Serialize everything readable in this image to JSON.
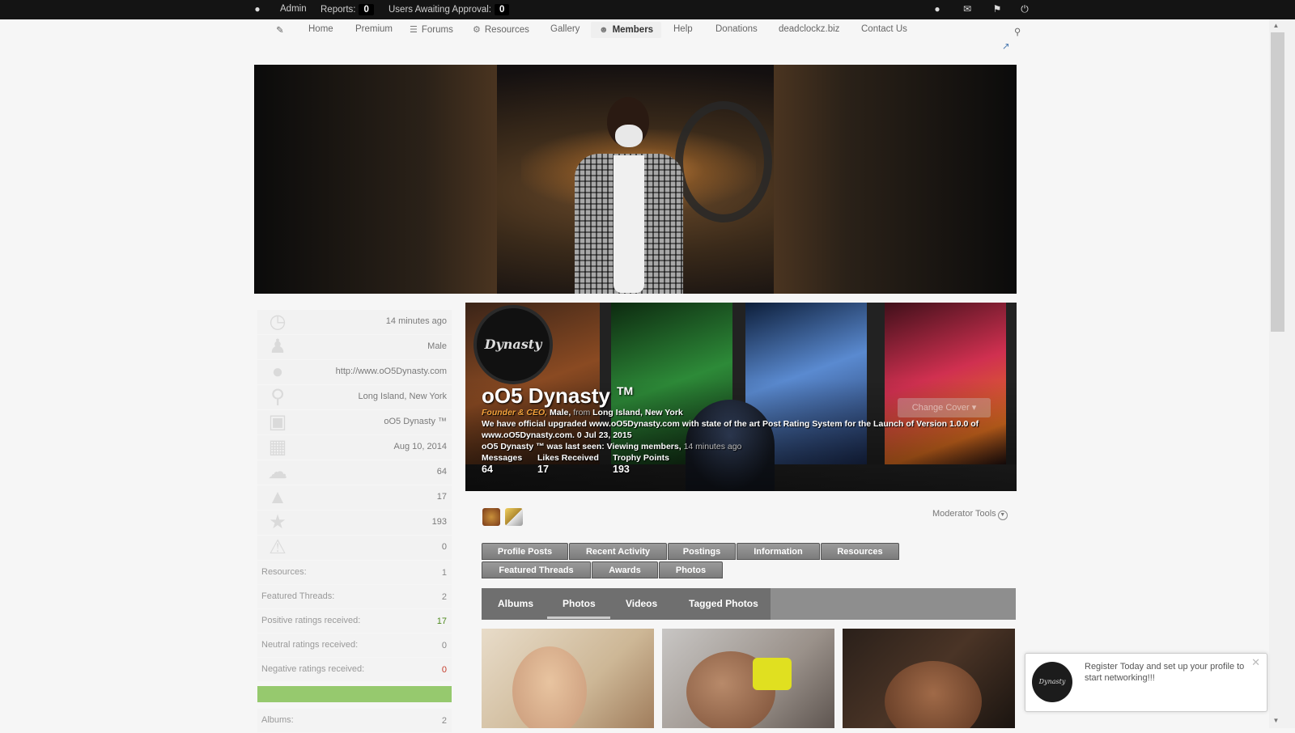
{
  "admin_bar": {
    "admin_label": "Admin",
    "reports_label": "Reports:",
    "reports_count": "0",
    "awaiting_label": "Users Awaiting Approval:",
    "awaiting_count": "0"
  },
  "nav": {
    "items": [
      {
        "label": "Home"
      },
      {
        "label": "Premium"
      },
      {
        "label": "Forums"
      },
      {
        "label": "Resources"
      },
      {
        "label": "Gallery"
      },
      {
        "label": "Members"
      },
      {
        "label": "Help"
      },
      {
        "label": "Donations"
      },
      {
        "label": "deadclockz.biz"
      },
      {
        "label": "Contact Us"
      }
    ]
  },
  "sidebar": {
    "rows": [
      {
        "icon": "clock-icon",
        "value": "14 minutes ago"
      },
      {
        "icon": "user-icon",
        "value": "Male"
      },
      {
        "icon": "globe-icon",
        "value": "http://www.oO5Dynasty.com"
      },
      {
        "icon": "location-pin-icon",
        "value": "Long Island, New York"
      },
      {
        "icon": "briefcase-icon",
        "value": "oO5 Dynasty ™"
      },
      {
        "icon": "calendar-icon",
        "value": "Aug 10, 2014"
      },
      {
        "icon": "speech-bubble-icon",
        "value": "64"
      },
      {
        "icon": "thumbs-up-icon",
        "value": "17"
      },
      {
        "icon": "trophy-icon",
        "value": "193"
      },
      {
        "icon": "warning-icon",
        "value": "0"
      }
    ],
    "details": [
      {
        "label": "Resources:",
        "value": "1"
      },
      {
        "label": "Featured Threads:",
        "value": "2"
      },
      {
        "label": "Positive ratings received:",
        "value": "17"
      },
      {
        "label": "Neutral ratings received:",
        "value": "0"
      },
      {
        "label": "Negative ratings received:",
        "value": "0"
      }
    ],
    "albums_label": "Albums:",
    "albums_value": "2"
  },
  "profile": {
    "avatar_text": "Dynasty",
    "name": "oO5 Dynasty",
    "tm": "TM",
    "title": "Founder & CEO,",
    "gender": "Male,",
    "from_label": "from",
    "location": "Long Island, New York",
    "status_line1": "We have official upgraded www.oO5Dynasty.com with state of the art Post Rating System for the Launch of Version 1.0.0 of",
    "status_line2": "www.oO5Dynasty.com. 0 Jul 23, 2015",
    "last_seen": "oO5 Dynasty ™ was last seen: Viewing members,",
    "last_seen_time": "14 minutes ago",
    "stats": [
      {
        "label": "Messages",
        "value": "64"
      },
      {
        "label": "Likes Received",
        "value": "17"
      },
      {
        "label": "Trophy Points",
        "value": "193"
      }
    ],
    "change_cover": "Change Cover"
  },
  "moderator_tools": "Moderator Tools",
  "tabs_row1": [
    "Profile Posts",
    "Recent Activity",
    "Postings",
    "Information",
    "Resources"
  ],
  "tabs_row2": [
    "Featured Threads",
    "Awards",
    "Photos"
  ],
  "subnav": [
    "Albums",
    "Photos",
    "Videos",
    "Tagged Photos"
  ],
  "toast": {
    "avatar_text": "Dynasty",
    "message": "Register Today and set up your profile to start networking!!!"
  }
}
